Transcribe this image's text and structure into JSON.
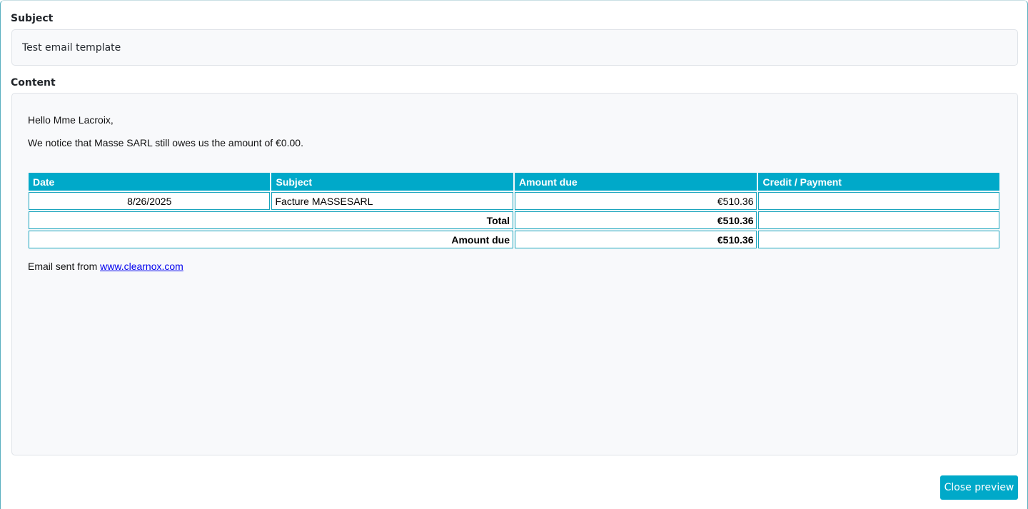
{
  "form": {
    "subject_label": "Subject",
    "subject_value": "Test email template",
    "content_label": "Content"
  },
  "email": {
    "greeting": "Hello Mme Lacroix,",
    "notice": "We notice that Masse SARL still owes us the amount of €0.00.",
    "table": {
      "headers": [
        "Date",
        "Subject",
        "Amount due",
        "Credit / Payment"
      ],
      "rows": [
        {
          "date": "8/26/2025",
          "subject": "Facture MASSESARL",
          "amount_due": "€510.36",
          "credit": ""
        }
      ],
      "total_label": "Total",
      "total_value": "€510.36",
      "amount_due_label": "Amount due",
      "amount_due_value": "€510.36"
    },
    "footer_prefix": "Email sent from ",
    "footer_link": "www.clearnox.com"
  },
  "actions": {
    "close_label": "Close preview"
  },
  "colors": {
    "accent": "#00a9c9"
  }
}
